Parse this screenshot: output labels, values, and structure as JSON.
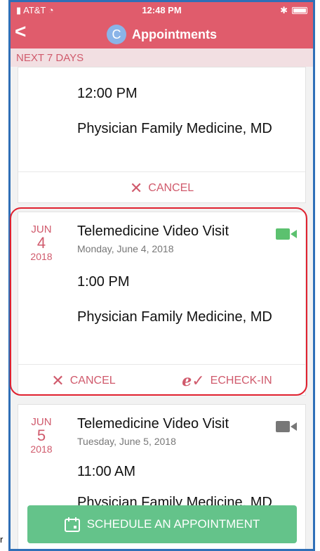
{
  "status_bar": {
    "carrier": "AT&T",
    "time": "12:48 PM"
  },
  "nav": {
    "back_label": "<",
    "avatar_letter": "C",
    "title": "Appointments"
  },
  "section": {
    "label": "NEXT 7 DAYS"
  },
  "appointments": [
    {
      "time": "12:00 PM",
      "provider": "Physician Family Medicine, MD",
      "cancel_label": "CANCEL"
    },
    {
      "month": "JUN",
      "day": "4",
      "year": "2018",
      "title": "Telemedicine Video Visit",
      "date_text": "Monday, June 4, 2018",
      "time": "1:00 PM",
      "provider": "Physician Family Medicine, MD",
      "cancel_label": "CANCEL",
      "checkin_label": "ECHECK-IN",
      "video_icon_color": "#5cc16f"
    },
    {
      "month": "JUN",
      "day": "5",
      "year": "2018",
      "title": "Telemedicine Video Visit",
      "date_text": "Tuesday, June 5, 2018",
      "time": "11:00 AM",
      "provider": "Physician Family Medicine, MD",
      "video_icon_color": "#777777"
    }
  ],
  "schedule_button": {
    "label": "SCHEDULE AN APPOINTMENT"
  },
  "edge_text": "r",
  "colors": {
    "header": "#e05c6c",
    "accent": "#d05a6c",
    "button": "#64c38a",
    "highlight": "#e0212f"
  },
  "icons": [
    "back-chevron-icon",
    "avatar-icon",
    "close-x-icon",
    "video-camera-icon",
    "echeck-in-icon",
    "calendar-icon"
  ]
}
